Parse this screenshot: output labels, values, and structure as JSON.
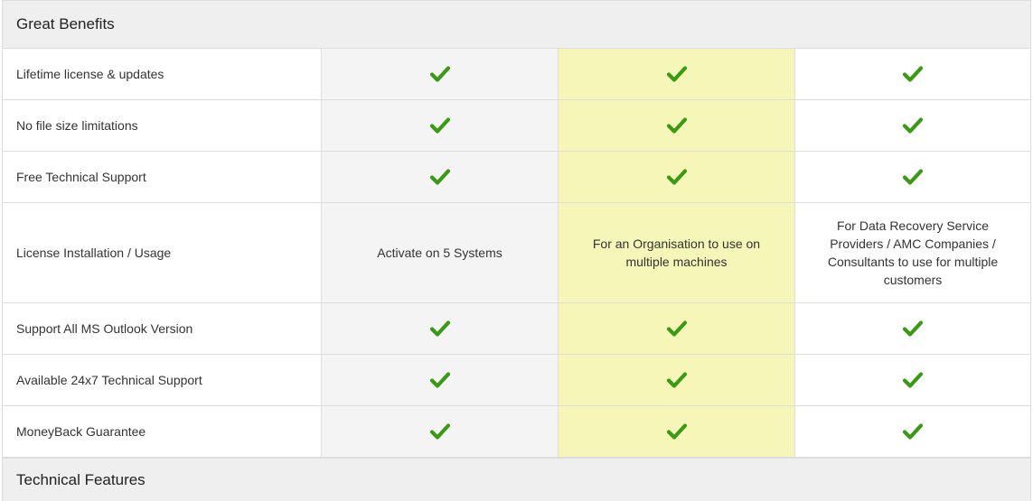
{
  "colors": {
    "check": "#3a9a14",
    "highlight_column": "#f6f6b8",
    "shaded_column": "#f4f4f4",
    "section_header_bg": "#efefef",
    "border": "#dddddd"
  },
  "sections": {
    "benefits_title": "Great Benefits",
    "technical_title": "Technical Features"
  },
  "rows": [
    {
      "label": "Lifetime license & updates",
      "values": [
        "check-icon",
        "check-icon",
        "check-icon"
      ]
    },
    {
      "label": "No file size limitations",
      "values": [
        "check-icon",
        "check-icon",
        "check-icon"
      ]
    },
    {
      "label": "Free Technical Support",
      "values": [
        "check-icon",
        "check-icon",
        "check-icon"
      ]
    },
    {
      "label": "License Installation / Usage",
      "values": [
        "Activate on 5 Systems",
        "For an Organisation to use on multiple machines",
        "For Data Recovery Service Providers / AMC Companies / Consultants to use for multiple customers"
      ]
    },
    {
      "label": "Support All MS Outlook Version",
      "values": [
        "check-icon",
        "check-icon",
        "check-icon"
      ]
    },
    {
      "label": "Available 24x7 Technical Support",
      "values": [
        "check-icon",
        "check-icon",
        "check-icon"
      ]
    },
    {
      "label": "MoneyBack Guarantee",
      "values": [
        "check-icon",
        "check-icon",
        "check-icon"
      ]
    }
  ]
}
